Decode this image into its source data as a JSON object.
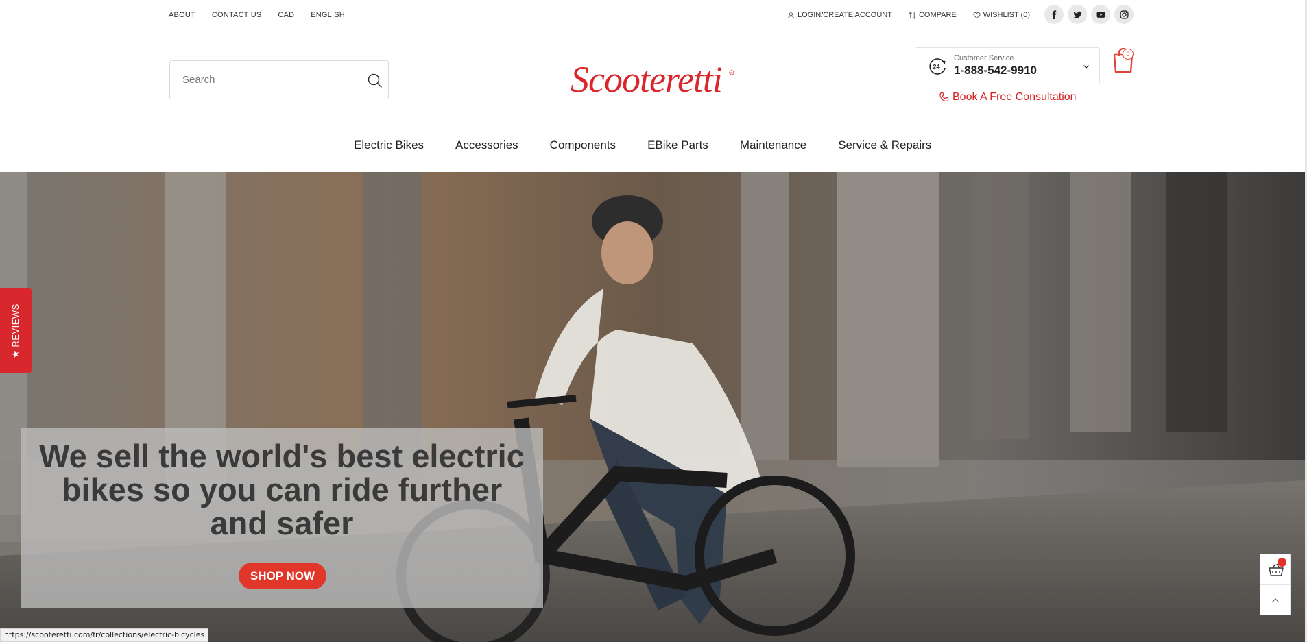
{
  "topbar": {
    "links": [
      "ABOUT",
      "CONTACT US",
      "CAD",
      "ENGLISH"
    ],
    "login_label": "LOGIN/CREATE ACCOUNT",
    "compare_label": "COMPARE",
    "wishlist_label": "WISHLIST (0)",
    "socials": [
      "facebook-icon",
      "twitter-icon",
      "youtube-icon",
      "instagram-icon"
    ]
  },
  "header": {
    "search_placeholder": "Search",
    "logo_text": "Scooteretti",
    "customer_service_label": "Customer Service",
    "customer_service_phone": "1-888-542-9910",
    "consultation_label": "Book A Free Consultation",
    "cart_count": "0"
  },
  "nav": {
    "items": [
      "Electric Bikes",
      "Accessories",
      "Components",
      "EBike Parts",
      "Maintenance",
      "Service & Repairs"
    ]
  },
  "hero": {
    "title": "We sell the world's best electric bikes so you can ride further and safer",
    "cta_label": "SHOP NOW"
  },
  "widgets": {
    "reviews_label": "★ REVIEWS"
  },
  "status_bar": {
    "url": "https://scooteretti.com/fr/collections/electric-bicycles"
  },
  "colors": {
    "brand_red": "#d9272e",
    "cta_red": "#e1372a"
  }
}
